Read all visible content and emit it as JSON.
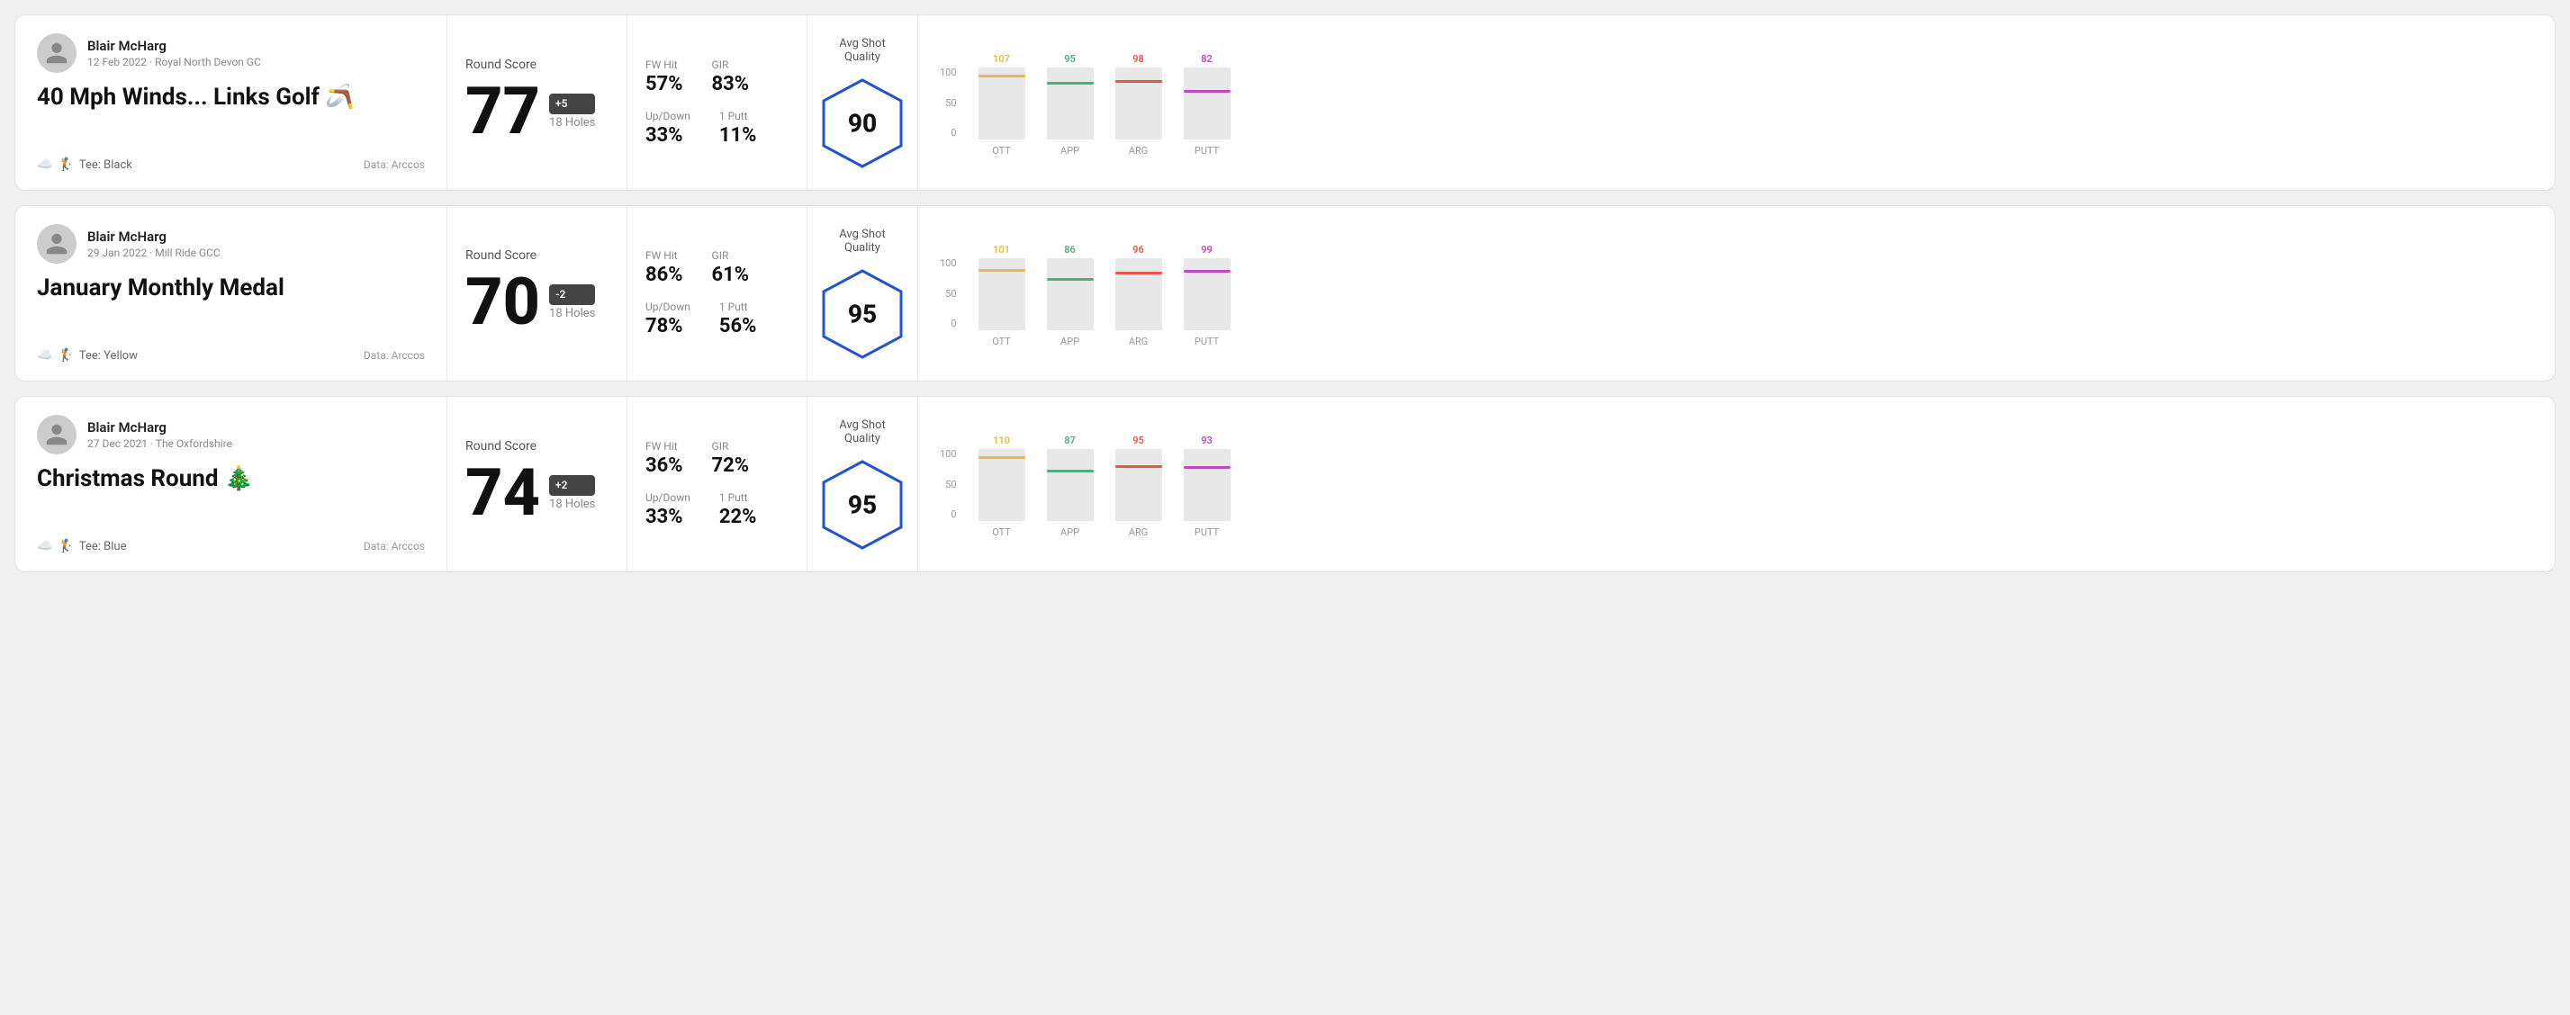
{
  "rounds": [
    {
      "id": "round-1",
      "user": {
        "name": "Blair McHarg",
        "date": "12 Feb 2022",
        "course": "Royal North Devon GC"
      },
      "title": "40 Mph Winds... Links Golf 🪃",
      "tee": "Black",
      "data_source": "Data: Arccos",
      "score": {
        "label": "Round Score",
        "value": "77",
        "badge": "+5",
        "holes": "18 Holes"
      },
      "stats": {
        "fw_hit_label": "FW Hit",
        "fw_hit_value": "57%",
        "gir_label": "GIR",
        "gir_value": "83%",
        "up_down_label": "Up/Down",
        "up_down_value": "33%",
        "one_putt_label": "1 Putt",
        "one_putt_value": "11%"
      },
      "avg_shot_quality": {
        "label": "Avg Shot Quality",
        "score": "90"
      },
      "chart": {
        "bars": [
          {
            "label": "OTT",
            "value": 107,
            "color": "#e8b84b",
            "pct": 100
          },
          {
            "label": "APP",
            "value": 95,
            "color": "#4caf7d",
            "pct": 89
          },
          {
            "label": "ARG",
            "value": 98,
            "color": "#e8554b",
            "pct": 92
          },
          {
            "label": "PUTT",
            "value": 82,
            "color": "#c048c0",
            "pct": 77
          }
        ],
        "y_labels": [
          "100",
          "50",
          "0"
        ]
      }
    },
    {
      "id": "round-2",
      "user": {
        "name": "Blair McHarg",
        "date": "29 Jan 2022",
        "course": "Mill Ride GCC"
      },
      "title": "January Monthly Medal",
      "tee": "Yellow",
      "data_source": "Data: Arccos",
      "score": {
        "label": "Round Score",
        "value": "70",
        "badge": "-2",
        "holes": "18 Holes"
      },
      "stats": {
        "fw_hit_label": "FW Hit",
        "fw_hit_value": "86%",
        "gir_label": "GIR",
        "gir_value": "61%",
        "up_down_label": "Up/Down",
        "up_down_value": "78%",
        "one_putt_label": "1 Putt",
        "one_putt_value": "56%"
      },
      "avg_shot_quality": {
        "label": "Avg Shot Quality",
        "score": "95"
      },
      "chart": {
        "bars": [
          {
            "label": "OTT",
            "value": 101,
            "color": "#e8b84b",
            "pct": 95
          },
          {
            "label": "APP",
            "value": 86,
            "color": "#4caf7d",
            "pct": 81
          },
          {
            "label": "ARG",
            "value": 96,
            "color": "#e8554b",
            "pct": 90
          },
          {
            "label": "PUTT",
            "value": 99,
            "color": "#c048c0",
            "pct": 93
          }
        ],
        "y_labels": [
          "100",
          "50",
          "0"
        ]
      }
    },
    {
      "id": "round-3",
      "user": {
        "name": "Blair McHarg",
        "date": "27 Dec 2021",
        "course": "The Oxfordshire"
      },
      "title": "Christmas Round 🎄",
      "tee": "Blue",
      "data_source": "Data: Arccos",
      "score": {
        "label": "Round Score",
        "value": "74",
        "badge": "+2",
        "holes": "18 Holes"
      },
      "stats": {
        "fw_hit_label": "FW Hit",
        "fw_hit_value": "36%",
        "gir_label": "GIR",
        "gir_value": "72%",
        "up_down_label": "Up/Down",
        "up_down_value": "33%",
        "one_putt_label": "1 Putt",
        "one_putt_value": "22%"
      },
      "avg_shot_quality": {
        "label": "Avg Shot Quality",
        "score": "95"
      },
      "chart": {
        "bars": [
          {
            "label": "OTT",
            "value": 110,
            "color": "#e8b84b",
            "pct": 100
          },
          {
            "label": "APP",
            "value": 87,
            "color": "#4caf7d",
            "pct": 79
          },
          {
            "label": "ARG",
            "value": 95,
            "color": "#e8554b",
            "pct": 86
          },
          {
            "label": "PUTT",
            "value": 93,
            "color": "#c048c0",
            "pct": 85
          }
        ],
        "y_labels": [
          "100",
          "50",
          "0"
        ]
      }
    }
  ]
}
